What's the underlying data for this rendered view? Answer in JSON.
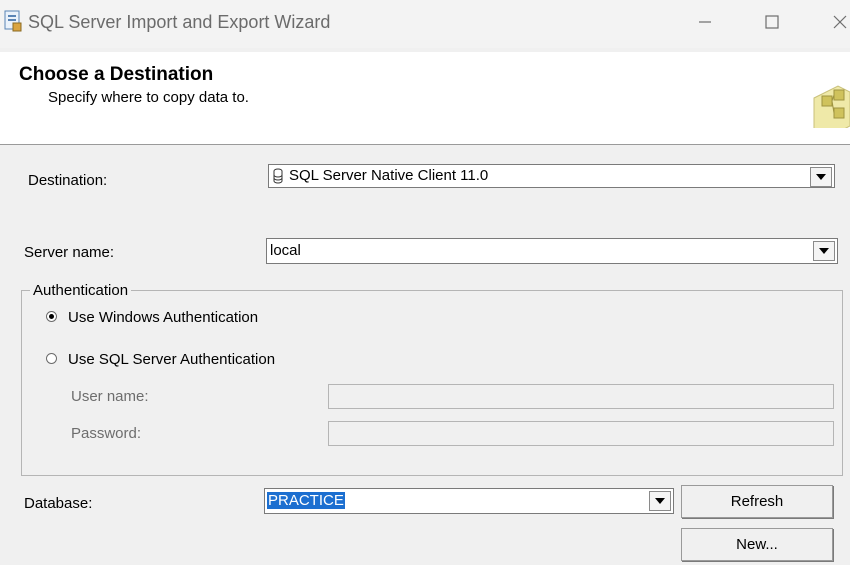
{
  "window": {
    "title": "SQL Server Import and Export Wizard",
    "controls": [
      "minimize",
      "maximize",
      "close"
    ]
  },
  "header": {
    "title": "Choose a Destination",
    "subtitle": "Specify where to copy data to."
  },
  "form": {
    "destination_label": "Destination:",
    "destination_value": "SQL Server Native Client 11.0",
    "server_label": "Server name:",
    "server_value": "local",
    "auth_group_label": "Authentication",
    "auth_options": [
      {
        "label": "Use Windows Authentication",
        "selected": true
      },
      {
        "label": "Use SQL Server Authentication",
        "selected": false
      }
    ],
    "username_label": "User name:",
    "username_value": "",
    "password_label": "Password:",
    "password_value": "",
    "database_label": "Database:",
    "database_value": "PRACTICE",
    "refresh_label": "Refresh",
    "new_label": "New..."
  },
  "colors": {
    "selection": "#1c6fd0",
    "window_bg": "#f0f0f0",
    "header_bg": "#ffffff"
  }
}
